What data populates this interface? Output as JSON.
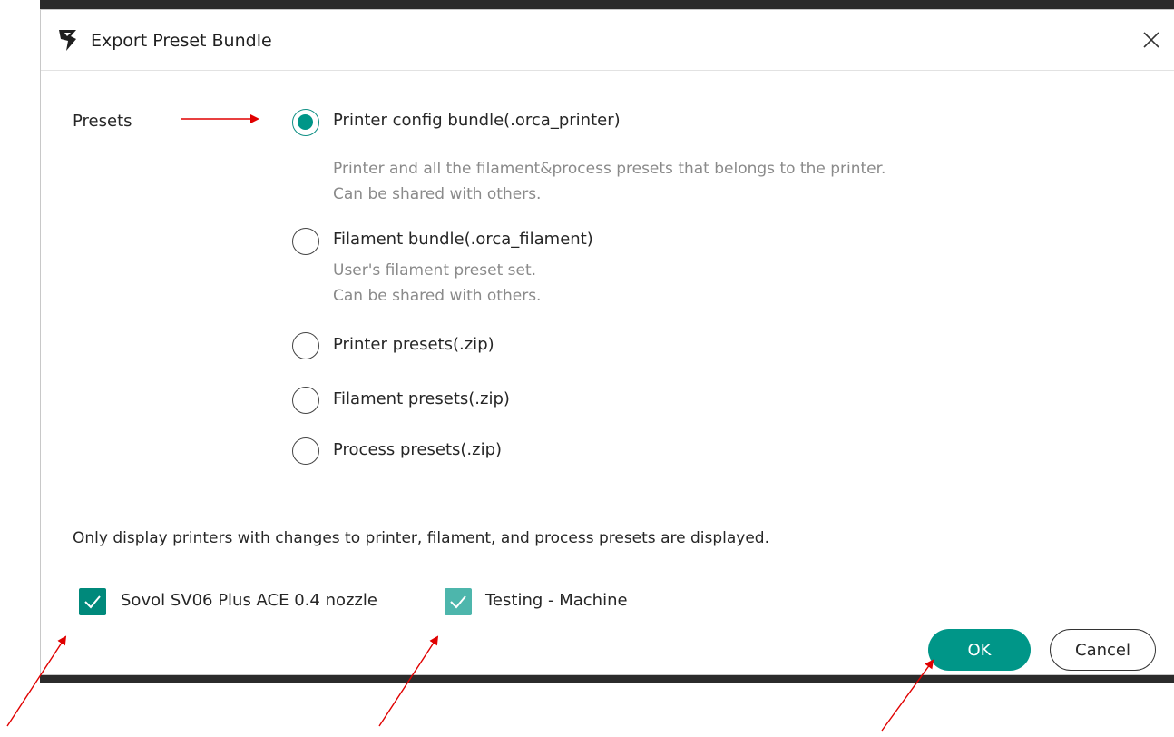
{
  "dialog": {
    "title": "Export Preset Bundle",
    "close_icon": "close-icon",
    "logo_icon": "orca-slicer-logo"
  },
  "presets": {
    "label": "Presets",
    "options": [
      {
        "label": "Printer config bundle(.orca_printer)",
        "checked": true,
        "desc": [
          "Printer and all the filament&process presets that belongs to the printer.",
          "Can be shared with others."
        ]
      },
      {
        "label": "Filament bundle(.orca_filament)",
        "checked": false,
        "desc": [
          "User's filament preset set.",
          "Can be shared with others."
        ]
      },
      {
        "label": "Printer presets(.zip)",
        "checked": false,
        "desc": []
      },
      {
        "label": "Filament presets(.zip)",
        "checked": false,
        "desc": []
      },
      {
        "label": "Process presets(.zip)",
        "checked": false,
        "desc": []
      }
    ]
  },
  "note": "Only display printers with changes to printer, filament, and process presets are displayed.",
  "printers": [
    {
      "label": "Sovol SV06 Plus ACE 0.4 nozzle",
      "checked": true
    },
    {
      "label": "Testing - Machine",
      "checked": true
    }
  ],
  "buttons": {
    "ok": "OK",
    "cancel": "Cancel"
  },
  "colors": {
    "accent": "#009688",
    "annotation_arrow": "#e00000"
  }
}
